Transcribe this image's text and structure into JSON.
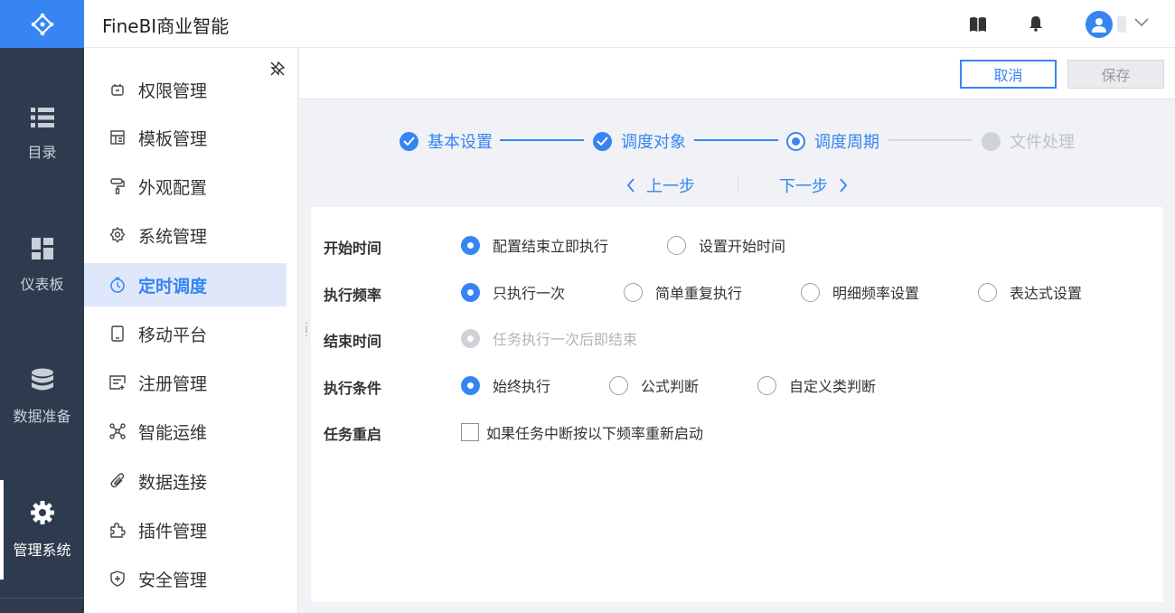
{
  "app": {
    "title": "FineBI商业智能"
  },
  "rail": {
    "items": [
      {
        "label": "目录",
        "icon": "list-icon"
      },
      {
        "label": "仪表板",
        "icon": "dashboard-icon"
      },
      {
        "label": "数据准备",
        "icon": "database-icon"
      },
      {
        "label": "管理系统",
        "icon": "gear-icon",
        "active": true
      }
    ]
  },
  "subnav": {
    "items": [
      {
        "label": "权限管理",
        "icon": "permission-icon"
      },
      {
        "label": "模板管理",
        "icon": "template-icon"
      },
      {
        "label": "外观配置",
        "icon": "paint-roller-icon"
      },
      {
        "label": "系统管理",
        "icon": "settings-icon"
      },
      {
        "label": "定时调度",
        "icon": "timer-icon",
        "active": true
      },
      {
        "label": "移动平台",
        "icon": "mobile-icon"
      },
      {
        "label": "注册管理",
        "icon": "register-icon"
      },
      {
        "label": "智能运维",
        "icon": "ops-icon"
      },
      {
        "label": "数据连接",
        "icon": "paperclip-icon"
      },
      {
        "label": "插件管理",
        "icon": "puzzle-icon"
      },
      {
        "label": "安全管理",
        "icon": "shield-icon"
      }
    ]
  },
  "actions": {
    "cancel": "取消",
    "save": "保存"
  },
  "steps": {
    "items": [
      {
        "label": "基本设置",
        "state": "done"
      },
      {
        "label": "调度对象",
        "state": "done"
      },
      {
        "label": "调度周期",
        "state": "current"
      },
      {
        "label": "文件处理",
        "state": "todo"
      }
    ],
    "prev": "上一步",
    "next": "下一步"
  },
  "form": {
    "start_time": {
      "label": "开始时间",
      "options": [
        {
          "label": "配置结束立即执行",
          "checked": true
        },
        {
          "label": "设置开始时间",
          "checked": false
        }
      ]
    },
    "frequency": {
      "label": "执行频率",
      "options": [
        {
          "label": "只执行一次",
          "checked": true
        },
        {
          "label": "简单重复执行",
          "checked": false
        },
        {
          "label": "明细频率设置",
          "checked": false
        },
        {
          "label": "表达式设置",
          "checked": false
        }
      ]
    },
    "end_time": {
      "label": "结束时间",
      "options": [
        {
          "label": "任务执行一次后即结束",
          "checked": true,
          "disabled": true
        }
      ]
    },
    "condition": {
      "label": "执行条件",
      "options": [
        {
          "label": "始终执行",
          "checked": true
        },
        {
          "label": "公式判断",
          "checked": false
        },
        {
          "label": "自定义类判断",
          "checked": false
        }
      ]
    },
    "restart": {
      "label": "任务重启",
      "checkbox_label": "如果任务中断按以下频率重新启动",
      "checked": false
    }
  },
  "colors": {
    "primary": "#3685f2",
    "rail_bg": "#2e3b4e",
    "active_nav_bg": "#dfe8fa"
  }
}
